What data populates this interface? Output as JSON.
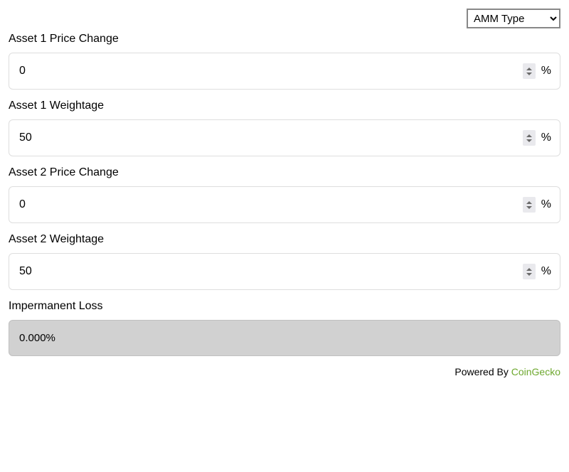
{
  "top": {
    "amm_type_label": "AMM Type"
  },
  "suffix_percent": "%",
  "fields": {
    "asset1_price_change": {
      "label": "Asset 1 Price Change",
      "value": "0"
    },
    "asset1_weightage": {
      "label": "Asset 1 Weightage",
      "value": "50"
    },
    "asset2_price_change": {
      "label": "Asset 2 Price Change",
      "value": "0"
    },
    "asset2_weightage": {
      "label": "Asset 2 Weightage",
      "value": "50"
    }
  },
  "result": {
    "label": "Impermanent Loss",
    "value": "0.000%"
  },
  "footer": {
    "prefix": "Powered By ",
    "link_text": "CoinGecko"
  }
}
